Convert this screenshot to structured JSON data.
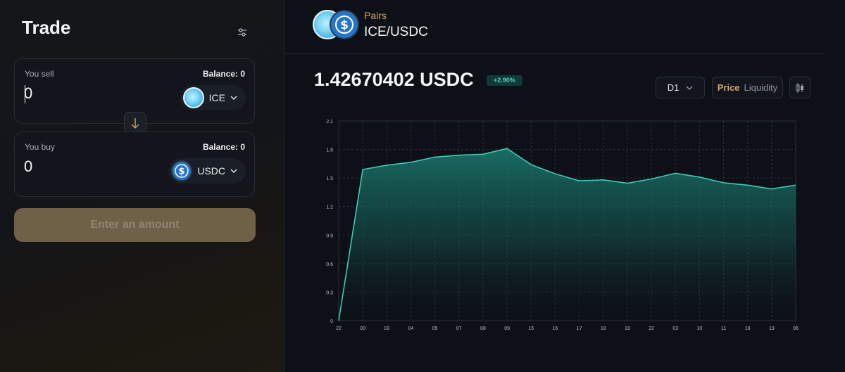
{
  "trade": {
    "title": "Trade",
    "sell": {
      "label": "You sell",
      "balance": "Balance: 0",
      "amount": "0",
      "token": "ICE"
    },
    "buy": {
      "label": "You buy",
      "balance": "Balance: 0",
      "amount": "0",
      "token": "USDC"
    },
    "submit_label": "Enter an amount"
  },
  "pair": {
    "label": "Pairs",
    "name": "ICE/USDC",
    "price": "1.42670402 USDC",
    "change": "+2.90%"
  },
  "controls": {
    "timeframe": "D1",
    "tab_price": "Price",
    "tab_liquidity": "Liquidity"
  },
  "colors": {
    "accent": "#d6a26a",
    "line": "#3ec8b7",
    "positive": "#4fd3c4"
  },
  "chart_data": {
    "type": "area",
    "x": [
      "22",
      "00",
      "03",
      "04",
      "05",
      "07",
      "08",
      "09",
      "15",
      "16",
      "17",
      "18",
      "19",
      "22",
      "03",
      "10",
      "11",
      "18",
      "19",
      "06"
    ],
    "values": [
      0,
      1.59,
      1.635,
      1.665,
      1.72,
      1.74,
      1.75,
      1.81,
      1.64,
      1.545,
      1.47,
      1.48,
      1.445,
      1.49,
      1.55,
      1.51,
      1.45,
      1.425,
      1.385,
      1.425
    ],
    "yticks": [
      0,
      0.3,
      0.6,
      0.9,
      1.2,
      1.5,
      1.8,
      2.1
    ],
    "ylim": [
      0,
      2.1
    ],
    "grid": true
  }
}
